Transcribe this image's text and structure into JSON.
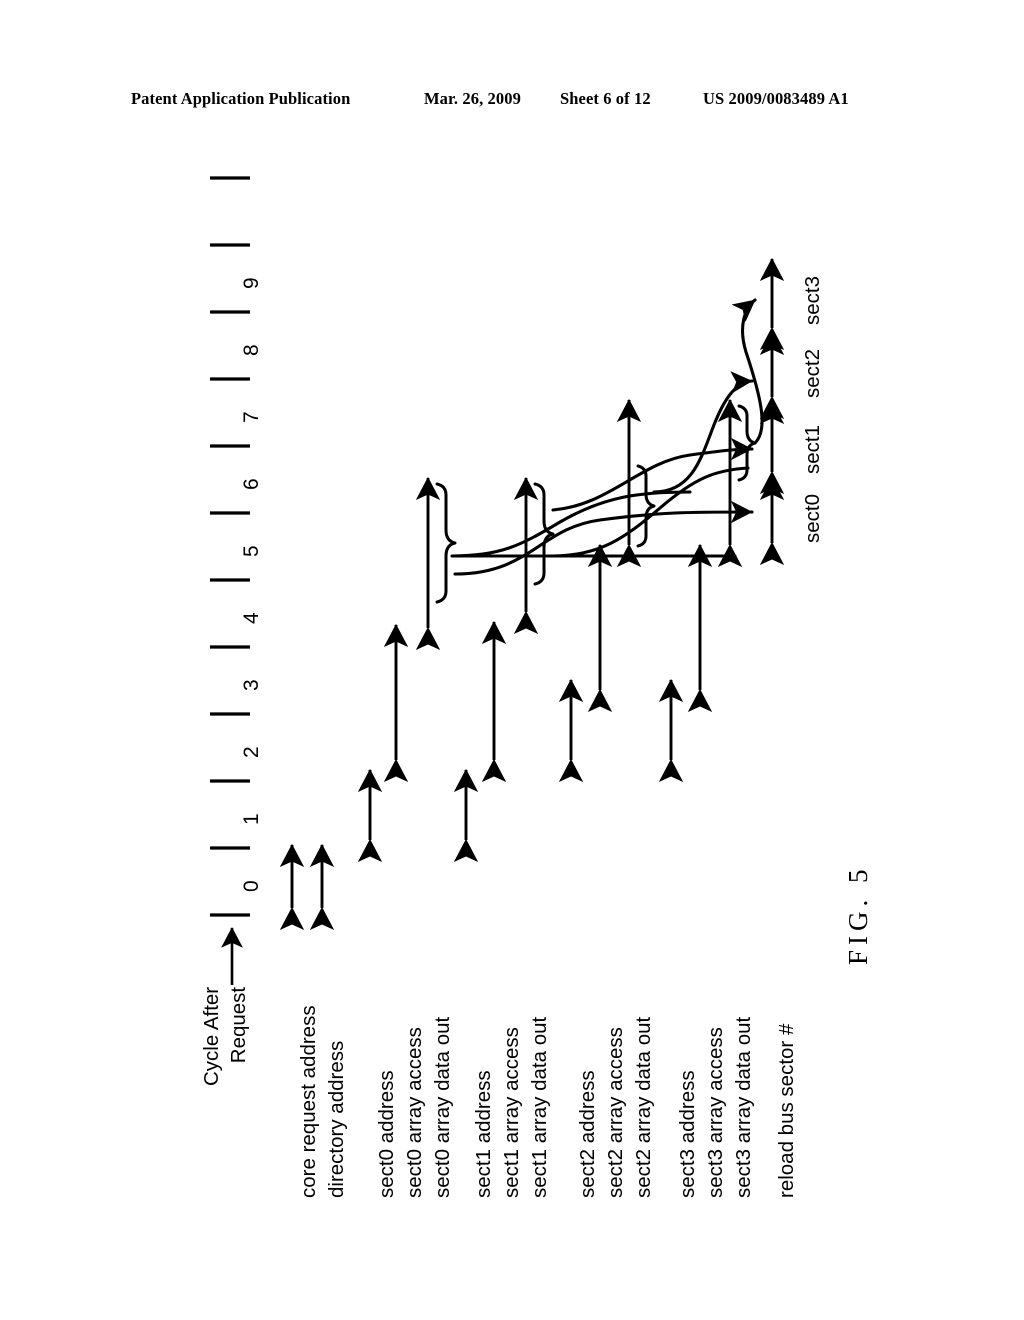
{
  "header": {
    "publication": "Patent Application Publication",
    "date": "Mar. 26, 2009",
    "sheet": "Sheet 6 of 12",
    "patent_number": "US 2009/0083489 A1"
  },
  "figure": {
    "caption": "FIG. 5",
    "axis": {
      "caption_line1": "Cycle After",
      "caption_line2": "Request",
      "ticks": [
        "0",
        "1",
        "2",
        "3",
        "4",
        "5",
        "6",
        "7",
        "8",
        "9"
      ]
    },
    "rows": [
      {
        "id": "core-request-address",
        "label": "core request address"
      },
      {
        "id": "directory-address",
        "label": "directory address"
      },
      {
        "id": "sect0-address",
        "label": "sect0 address"
      },
      {
        "id": "sect0-array-access",
        "label": "sect0 array access"
      },
      {
        "id": "sect0-array-data-out",
        "label": "sect0 array data out"
      },
      {
        "id": "sect1-address",
        "label": "sect1 address"
      },
      {
        "id": "sect1-array-access",
        "label": "sect1 array access"
      },
      {
        "id": "sect1-array-data-out",
        "label": "sect1 array data out"
      },
      {
        "id": "sect2-address",
        "label": "sect2 address"
      },
      {
        "id": "sect2-array-access",
        "label": "sect2 array access"
      },
      {
        "id": "sect2-array-data-out",
        "label": "sect2 array data out"
      },
      {
        "id": "sect3-address",
        "label": "sect3 address"
      },
      {
        "id": "sect3-array-access",
        "label": "sect3 array access"
      },
      {
        "id": "sect3-array-data-out",
        "label": "sect3 array data out"
      },
      {
        "id": "reload-bus-sector",
        "label": "reload bus sector #"
      }
    ],
    "reload_bus_sectors": [
      "sect0",
      "sect1",
      "sect2",
      "sect3"
    ]
  },
  "chart_data": {
    "type": "timing-diagram",
    "title": "FIG. 5",
    "orientation": "rotated-90-ccw",
    "xlabel": "Cycle After Request",
    "x_ticks": [
      0,
      1,
      2,
      3,
      4,
      5,
      6,
      7,
      8,
      9
    ],
    "signals": [
      {
        "name": "core request address",
        "start_cycle": 0,
        "end_cycle": 1
      },
      {
        "name": "directory address",
        "start_cycle": 0,
        "end_cycle": 1
      },
      {
        "name": "sect0 address",
        "start_cycle": 1,
        "end_cycle": 2
      },
      {
        "name": "sect0 array access",
        "start_cycle": 2,
        "end_cycle": 4
      },
      {
        "name": "sect0 array data out",
        "start_cycle": 4,
        "end_cycle": 5
      },
      {
        "name": "sect1 address",
        "start_cycle": 1,
        "end_cycle": 3
      },
      {
        "name": "sect1 array access",
        "start_cycle": 3,
        "end_cycle": 5
      },
      {
        "name": "sect1 array data out",
        "start_cycle": 5,
        "end_cycle": 6
      },
      {
        "name": "sect2 address",
        "start_cycle": 2,
        "end_cycle": 4
      },
      {
        "name": "sect2 array access",
        "start_cycle": 4,
        "end_cycle": 6
      },
      {
        "name": "sect2 array data out",
        "start_cycle": 6,
        "end_cycle": 7
      },
      {
        "name": "sect3 address",
        "start_cycle": 2,
        "end_cycle": 4
      },
      {
        "name": "sect3 array access",
        "start_cycle": 4,
        "end_cycle": 6
      },
      {
        "name": "sect3 array data out",
        "start_cycle": 6,
        "end_cycle": 7
      },
      {
        "name": "reload bus sector #",
        "sectors": [
          "sect0",
          "sect1",
          "sect2",
          "sect3"
        ]
      }
    ],
    "notes": "Double-headed arrows mark the duration of each phase; curly braces and curved connectors route array data-out results onto the reload bus sector slots."
  }
}
